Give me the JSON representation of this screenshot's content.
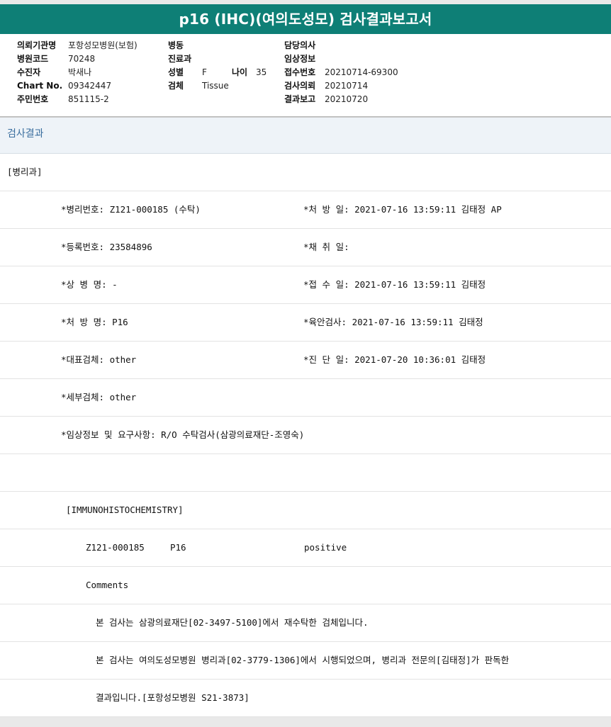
{
  "title": "p16 (IHC)(여의도성모) 검사결과보고서",
  "header": {
    "col1": [
      {
        "label": "의뢰기관명",
        "value": "포항성모병원(보험)"
      },
      {
        "label": "병원코드",
        "value": "70248"
      },
      {
        "label": "수진자",
        "value": "박새나"
      },
      {
        "label": "Chart No.",
        "value": "09342447"
      },
      {
        "label": "주민번호",
        "value": "851115-2"
      }
    ],
    "col2": [
      {
        "label": "병동",
        "value": ""
      },
      {
        "label": "진료과",
        "value": ""
      },
      {
        "label": "성별",
        "value": "F",
        "label2": "나이",
        "value2": "35"
      },
      {
        "label": "검체",
        "value": "Tissue"
      }
    ],
    "col3": [
      {
        "label": "담당의사",
        "value": ""
      },
      {
        "label": "임상정보",
        "value": ""
      },
      {
        "label": "접수번호",
        "value": "20210714-69300"
      },
      {
        "label": "검사의뢰",
        "value": "20210714"
      },
      {
        "label": "결과보고",
        "value": "20210720"
      }
    ]
  },
  "section_title": "검사결과",
  "rows": [
    {
      "left": "[병리과]",
      "right": ""
    },
    {
      "left": "*병리번호: Z121-000185 (수탁)",
      "right": "*처 방 일: 2021-07-16 13:59:11  김태정 AP"
    },
    {
      "left": "*등록번호: 23584896",
      "right": "*채 취 일:"
    },
    {
      "left": "*상 병 명: -",
      "right": "*접 수 일: 2021-07-16 13:59:11  김태정"
    },
    {
      "left": "*처 방 명: P16",
      "right": "*육안검사: 2021-07-16 13:59:11  김태정"
    },
    {
      "left": "*대표검체: other",
      "right": "*진 단 일: 2021-07-20 10:36:01  김태정"
    },
    {
      "left": "*세부검체: other",
      "right": ""
    },
    {
      "left": "*임상정보 및 요구사항: R/O 수탁검사(삼광의료재단-조영숙)",
      "right": ""
    },
    {
      "left": "",
      "right": ""
    },
    {
      "left": "[IMMUNOHISTOCHEMISTRY]",
      "right": ""
    },
    {
      "left": "Z121-000185",
      "mid": "P16",
      "right": "positive"
    },
    {
      "left": "Comments",
      "right": ""
    },
    {
      "left": "본 검사는 삼광의료재단[02-3497-5100]에서 재수탁한 검체입니다.",
      "right": ""
    },
    {
      "left": "본 검사는 여의도성모병원 병리과[02-3779-1306]에서 시행되었으며, 병리과 전문의[김태정]가 판독한",
      "right": ""
    },
    {
      "left": "결과입니다.[포항성모병원 S21-3873]",
      "right": ""
    }
  ]
}
